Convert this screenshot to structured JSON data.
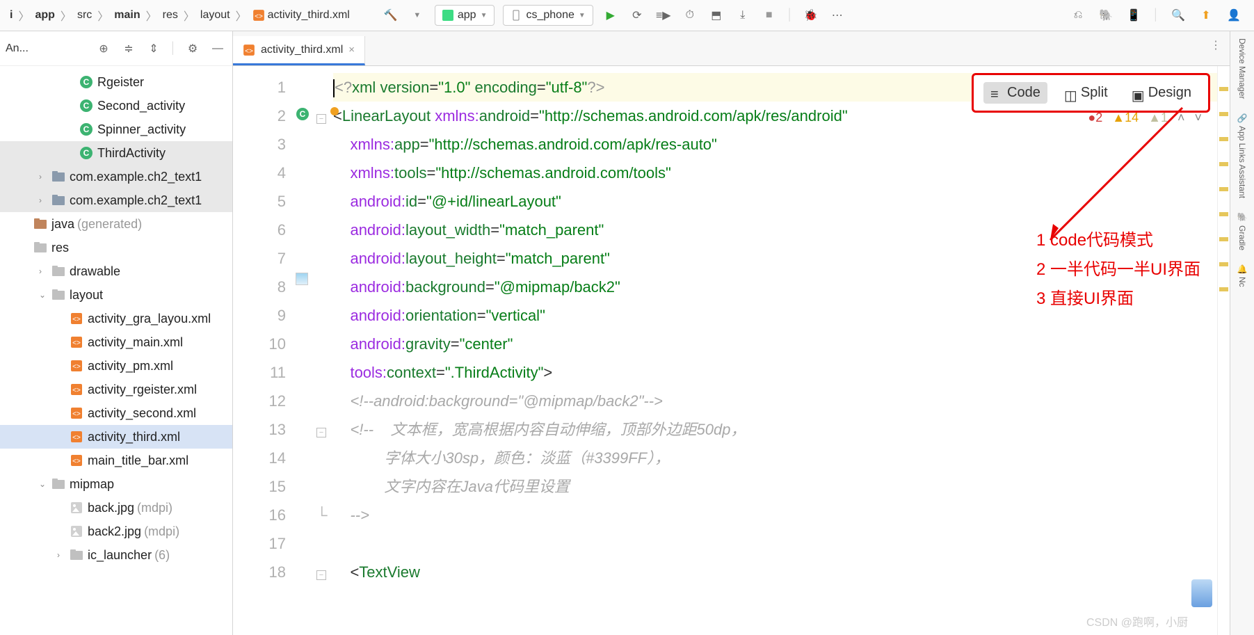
{
  "breadcrumb": [
    "i",
    "app",
    "src",
    "main",
    "res",
    "layout",
    "activity_third.xml"
  ],
  "toolbar": {
    "app_dropdown": "app",
    "device_dropdown": "cs_phone"
  },
  "sidebar": {
    "header": "An...",
    "items": [
      {
        "label": "Rgeister",
        "icon": "c",
        "indent": 4
      },
      {
        "label": "Second_activity",
        "icon": "c",
        "indent": 4
      },
      {
        "label": "Spinner_activity",
        "icon": "c",
        "indent": 4
      },
      {
        "label": "ThirdActivity",
        "icon": "c",
        "indent": 4,
        "hl": true
      },
      {
        "label": "com.example.ch2_text1",
        "icon": "pkg",
        "indent": 2,
        "arrow": ">",
        "hl": true
      },
      {
        "label": "com.example.ch2_text1",
        "icon": "pkg",
        "indent": 2,
        "arrow": ">",
        "hl": true
      },
      {
        "label": "java",
        "hint": "(generated)",
        "icon": "gen",
        "indent": 1
      },
      {
        "label": "res",
        "icon": "folder",
        "indent": 1
      },
      {
        "label": "drawable",
        "icon": "folder",
        "indent": 2,
        "arrow": ">"
      },
      {
        "label": "layout",
        "icon": "folder",
        "indent": 2,
        "arrow": "v"
      },
      {
        "label": "activity_gra_layou.xml",
        "icon": "xml",
        "indent": 3,
        "trunc": true
      },
      {
        "label": "activity_main.xml",
        "icon": "xml",
        "indent": 3
      },
      {
        "label": "activity_pm.xml",
        "icon": "xml",
        "indent": 3
      },
      {
        "label": "activity_rgeister.xml",
        "icon": "xml",
        "indent": 3
      },
      {
        "label": "activity_second.xml",
        "icon": "xml",
        "indent": 3
      },
      {
        "label": "activity_third.xml",
        "icon": "xml",
        "indent": 3,
        "sel": true
      },
      {
        "label": "main_title_bar.xml",
        "icon": "xml",
        "indent": 3
      },
      {
        "label": "mipmap",
        "icon": "folder",
        "indent": 2,
        "arrow": "v"
      },
      {
        "label": "back.jpg",
        "hint": "(mdpi)",
        "icon": "img",
        "indent": 3
      },
      {
        "label": "back2.jpg",
        "hint": "(mdpi)",
        "icon": "img",
        "indent": 3
      },
      {
        "label": "ic_launcher",
        "hint": "(6)",
        "icon": "folder",
        "indent": 3,
        "arrow": ">"
      }
    ]
  },
  "tab": {
    "label": "activity_third.xml"
  },
  "view_modes": {
    "code": "Code",
    "split": "Split",
    "design": "Design"
  },
  "warnings": {
    "errors": "2",
    "warns": "14",
    "weak": "1"
  },
  "annotations": {
    "l1": "1 code代码模式",
    "l2": "2 一半代码一半UI界面",
    "l3": "3 直接UI界面"
  },
  "code_lines": [
    {
      "n": 1,
      "html": "<span class='k-xml'>&lt;?</span><span class='k-tag'>xml</span> <span class='k-attr'>version</span>=<span class='k-val'>\"1.0\"</span> <span class='k-attr'>encoding</span>=<span class='k-val'>\"utf-8\"</span><span class='k-xml'>?&gt;</span>",
      "hl": true,
      "caret": true
    },
    {
      "n": 2,
      "html": "&lt;<span class='k-tag'>LinearLayout</span> <span class='k-ns'>xmlns:</span><span class='k-attr'>android</span>=<span class='k-val'>\"http://schemas.android.com/apk/res/android\"</span>",
      "mark": "c",
      "fold": "-",
      "dot": true
    },
    {
      "n": 3,
      "html": "    <span class='k-ns'>xmlns:</span><span class='k-attr'>app</span>=<span class='k-val'>\"http://schemas.android.com/apk/res-auto\"</span>"
    },
    {
      "n": 4,
      "html": "    <span class='k-ns'>xmlns:</span><span class='k-attr'>tools</span>=<span class='k-val'>\"http://schemas.android.com/tools\"</span>"
    },
    {
      "n": 5,
      "html": "    <span class='k-ns'>android:</span><span class='k-attr'>id</span>=<span class='k-val'>\"@+id/linearLayout\"</span>"
    },
    {
      "n": 6,
      "html": "    <span class='k-ns'>android:</span><span class='k-attr'>layout_width</span>=<span class='k-val'>\"match_parent\"</span>"
    },
    {
      "n": 7,
      "html": "    <span class='k-ns'>android:</span><span class='k-attr'>layout_height</span>=<span class='k-val'>\"match_parent\"</span>"
    },
    {
      "n": 8,
      "html": "    <span class='k-ns'>android:</span><span class='k-attr'>background</span>=<span class='k-val'>\"@mipmap/back2\"</span>",
      "thumb": true
    },
    {
      "n": 9,
      "html": "    <span class='k-ns'>android:</span><span class='k-attr'>orientation</span>=<span class='k-val'>\"vertical\"</span>"
    },
    {
      "n": 10,
      "html": "    <span class='k-ns'>android:</span><span class='k-attr'>gravity</span>=<span class='k-val'>\"center\"</span>"
    },
    {
      "n": 11,
      "html": "    <span class='k-ns'>tools:</span><span class='k-attr'>context</span>=<span class='k-val'>\".ThirdActivity\"</span>&gt;"
    },
    {
      "n": 12,
      "html": "    <span class='k-cmt'>&lt;!--android:background=\"@mipmap/back2\"--&gt;</span>"
    },
    {
      "n": 13,
      "html": "    <span class='k-cmt'>&lt;!--    文本框，宽高根据内容自动伸缩，顶部外边距50dp，</span>",
      "fold": "-"
    },
    {
      "n": 14,
      "html": "            <span class='k-cmt'>字体大小30sp，颜色：淡蓝（#3399FF），</span>"
    },
    {
      "n": 15,
      "html": "            <span class='k-cmt'>文字内容在Java代码里设置</span>"
    },
    {
      "n": 16,
      "html": "    <span class='k-cmt'>--&gt;</span>",
      "fold": "_"
    },
    {
      "n": 17,
      "html": ""
    },
    {
      "n": 18,
      "html": "    &lt;<span class='k-tag'>TextView</span>",
      "fold": "-"
    }
  ],
  "rail": [
    "Device Manager",
    "App Links Assistant",
    "Gradle",
    "Nc"
  ],
  "watermark": "CSDN @跑啊，小厨"
}
